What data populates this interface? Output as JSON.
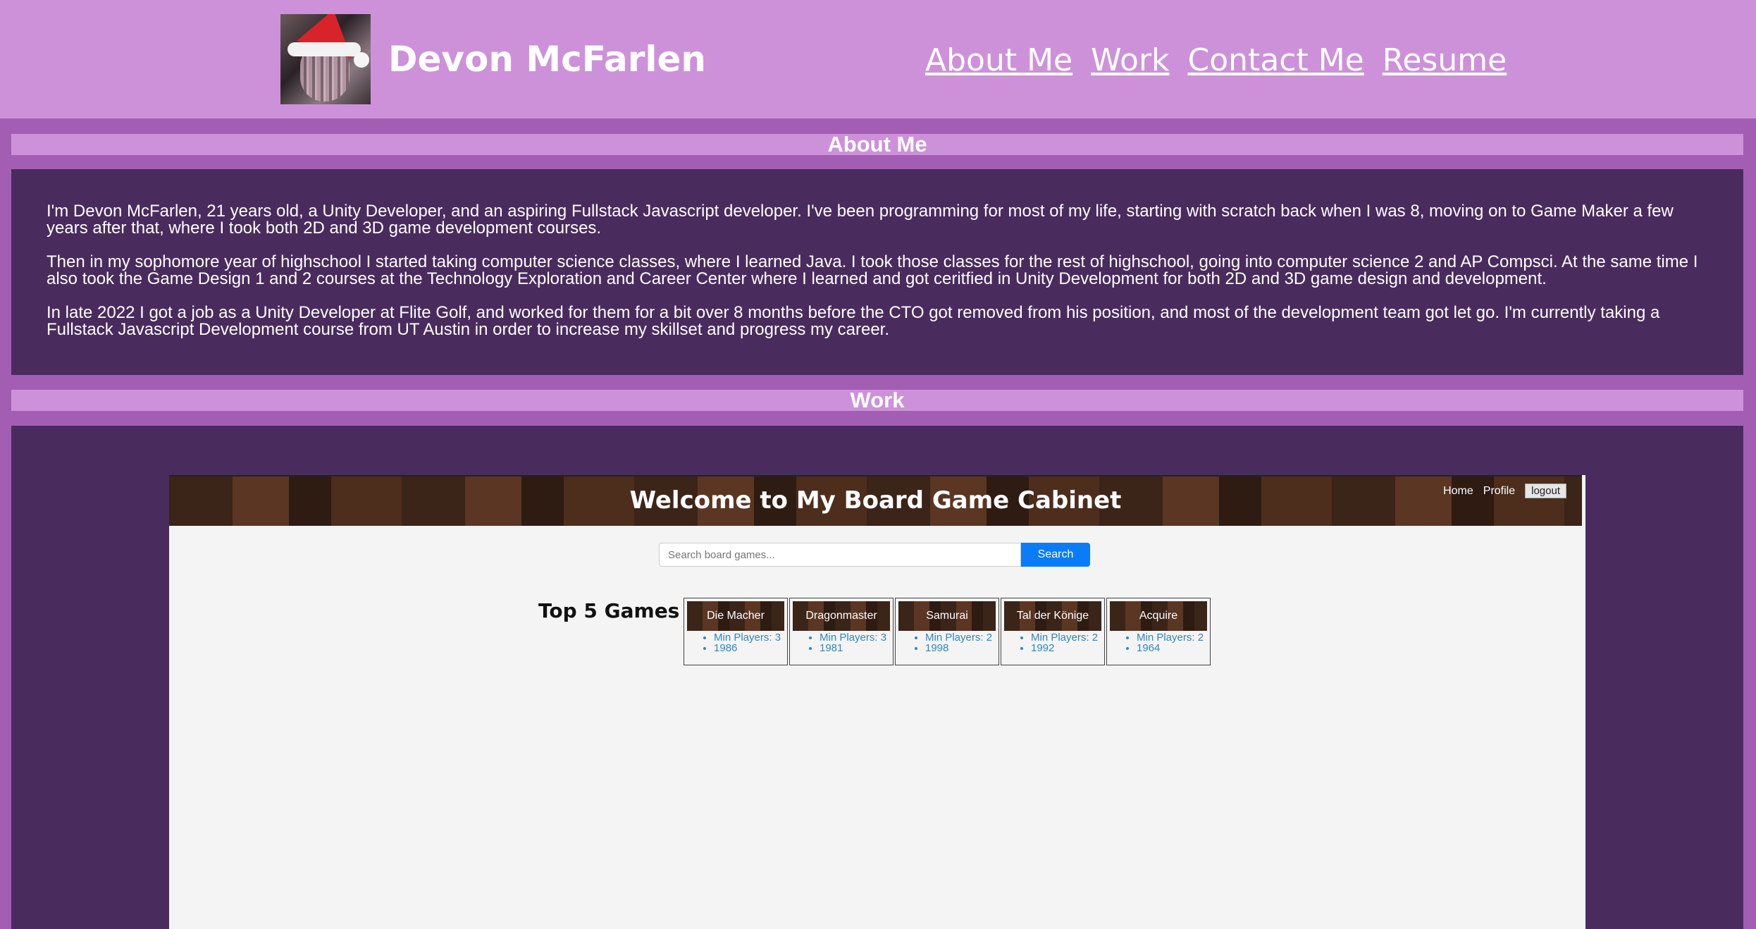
{
  "header": {
    "name": "Devon McFarlen",
    "nav": [
      "About Me",
      "Work",
      "Contact Me",
      "Resume"
    ]
  },
  "about": {
    "heading": "About Me",
    "paragraphs": [
      "I'm Devon McFarlen, 21 years old, a Unity Developer, and an aspiring Fullstack Javascript developer. I've been programming for most of my life, starting with scratch back when I was 8, moving on to Game Maker a few years after that, where I took both 2D and 3D game development courses.",
      "Then in my sophomore year of highschool I started taking computer science classes, where I learned Java. I took those classes for the rest of highschool, going into computer science 2 and AP Compsci. At the same time I also took the Game Design 1 and 2 courses at the Technology Exploration and Career Center where I learned and got ceritfied in Unity Development for both 2D and 3D game design and development.",
      "In late 2022 I got a job as a Unity Developer at Flite Golf, and worked for them for a bit over 8 months before the CTO got removed from his position, and most of the development team got let go. I'm currently taking a Fullstack Javascript Development course from UT Austin in order to increase my skillset and progress my career."
    ]
  },
  "work": {
    "heading": "Work",
    "project": {
      "title": "Welcome to My Board Game Cabinet",
      "nav": {
        "home": "Home",
        "profile": "Profile",
        "logout": "logout"
      },
      "search_placeholder": "Search board games...",
      "search_label": "Search",
      "top_heading": "Top 5 Games",
      "games": [
        {
          "name": "Die Macher",
          "players": "Min Players: 3",
          "year": "1986"
        },
        {
          "name": "Dragonmaster",
          "players": "Min Players: 3",
          "year": "1981"
        },
        {
          "name": "Samurai",
          "players": "Min Players: 2",
          "year": "1998"
        },
        {
          "name": "Tal der Könige",
          "players": "Min Players: 2",
          "year": "1992"
        },
        {
          "name": "Acquire",
          "players": "Min Players: 2",
          "year": "1964"
        }
      ]
    }
  }
}
